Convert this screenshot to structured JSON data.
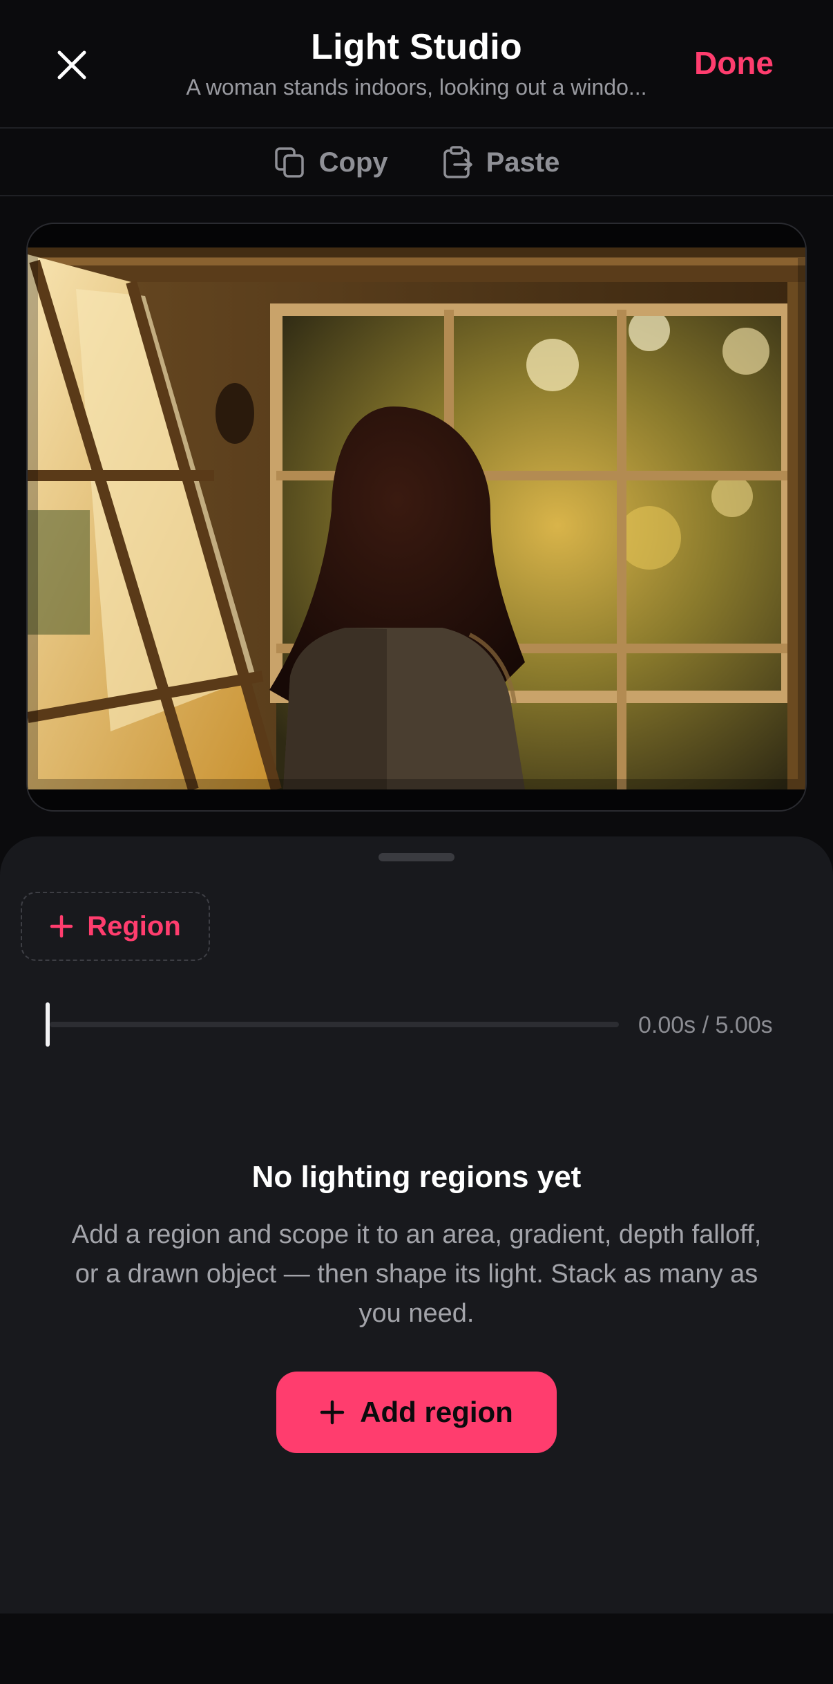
{
  "header": {
    "title": "Light Studio",
    "subtitle": "A woman stands indoors, looking out a windo...",
    "close_icon": "close-icon",
    "done_label": "Done"
  },
  "toolbar": {
    "copy_label": "Copy",
    "copy_icon": "copy-icon",
    "paste_label": "Paste",
    "paste_icon": "clipboard-icon"
  },
  "sheet": {
    "region_chip_label": "Region",
    "timecode": "0.00s / 5.00s",
    "playhead_progress": 0,
    "empty_title": "No lighting regions yet",
    "empty_desc": "Add a region and scope it to an area, gradient, depth falloff, or a drawn object — then shape its light. Stack as many as you need.",
    "add_region_label": "Add region"
  },
  "colors": {
    "accent": "#ff3d6e",
    "background": "#0b0b0d",
    "sheet": "#18191d"
  }
}
